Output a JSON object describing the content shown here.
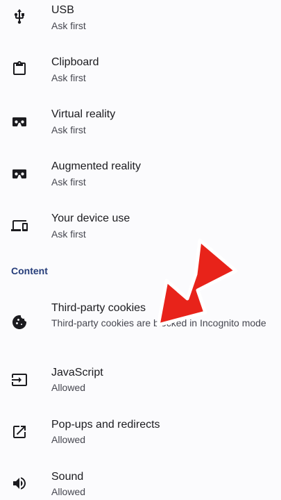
{
  "permissions": [
    {
      "title": "USB",
      "status": "Ask first",
      "icon": "usb-icon"
    },
    {
      "title": "Clipboard",
      "status": "Ask first",
      "icon": "clipboard-icon"
    },
    {
      "title": "Virtual reality",
      "status": "Ask first",
      "icon": "vr-headset-icon"
    },
    {
      "title": "Augmented reality",
      "status": "Ask first",
      "icon": "ar-headset-icon"
    },
    {
      "title": "Your device use",
      "status": "Ask first",
      "icon": "devices-icon"
    }
  ],
  "content_section": {
    "header": "Content",
    "items": [
      {
        "title": "Third-party cookies",
        "status": "Third-party cookies are blocked in Incognito mode",
        "icon": "cookie-icon"
      },
      {
        "title": "JavaScript",
        "status": "Allowed",
        "icon": "javascript-icon"
      },
      {
        "title": "Pop-ups and redirects",
        "status": "Allowed",
        "icon": "popup-icon"
      },
      {
        "title": "Sound",
        "status": "Allowed",
        "icon": "sound-icon"
      }
    ]
  },
  "colors": {
    "background": "#fbfbfd",
    "section_header": "#263d7a",
    "annotation_arrow": "#e8231a"
  }
}
